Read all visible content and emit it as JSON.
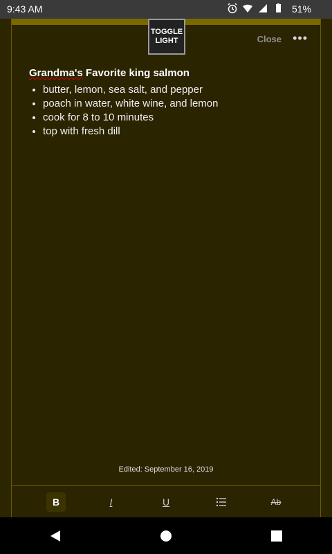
{
  "status": {
    "time": "9:43 AM",
    "battery": "51%"
  },
  "toolbar_top": {
    "toggle_label_line1": "TOGGLE",
    "toggle_label_line2": "LIGHT",
    "close_label": "Close",
    "more_label": "•••"
  },
  "note": {
    "title_part1": "Grandma's",
    "title_part2": " Favorite king salmon",
    "bullets": [
      "butter, lemon, sea salt, and pepper",
      "poach in water, white wine, and lemon",
      "cook for 8 to 10 minutes",
      "top with fresh dill"
    ],
    "edited": "Edited: September 16, 2019"
  },
  "format_toolbar": {
    "bold": "B",
    "italic": "I",
    "underline": "U",
    "strike": "Ab"
  }
}
